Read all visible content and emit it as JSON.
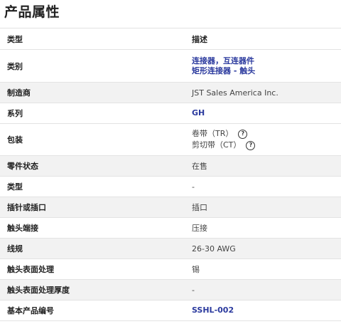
{
  "page_title": "产品属性",
  "header": {
    "type": "类型",
    "desc": "描述"
  },
  "rows": {
    "category": {
      "label": "类别",
      "links": [
        "连接器，互连器件",
        "矩形连接器 - 触头"
      ]
    },
    "mfr": {
      "label": "制造商",
      "value": "JST Sales America Inc."
    },
    "series": {
      "label": "系列",
      "link": "GH"
    },
    "packaging": {
      "label": "包装",
      "options": [
        "卷带（TR）",
        "剪切带（CT）"
      ]
    },
    "status": {
      "label": "零件状态",
      "value": "在售"
    },
    "type": {
      "label": "类型",
      "value": "-"
    },
    "pin_socket": {
      "label": "插针或插口",
      "value": "插口"
    },
    "termination": {
      "label": "触头端接",
      "value": "压接"
    },
    "gauge": {
      "label": "线规",
      "value": "26-30 AWG"
    },
    "finish": {
      "label": "触头表面处理",
      "value": "锡"
    },
    "finish_thickness": {
      "label": "触头表面处理厚度",
      "value": "-"
    },
    "base_part": {
      "label": "基本产品编号",
      "link": "SSHL-002"
    }
  },
  "icons": {
    "help": "help-circle-icon"
  }
}
